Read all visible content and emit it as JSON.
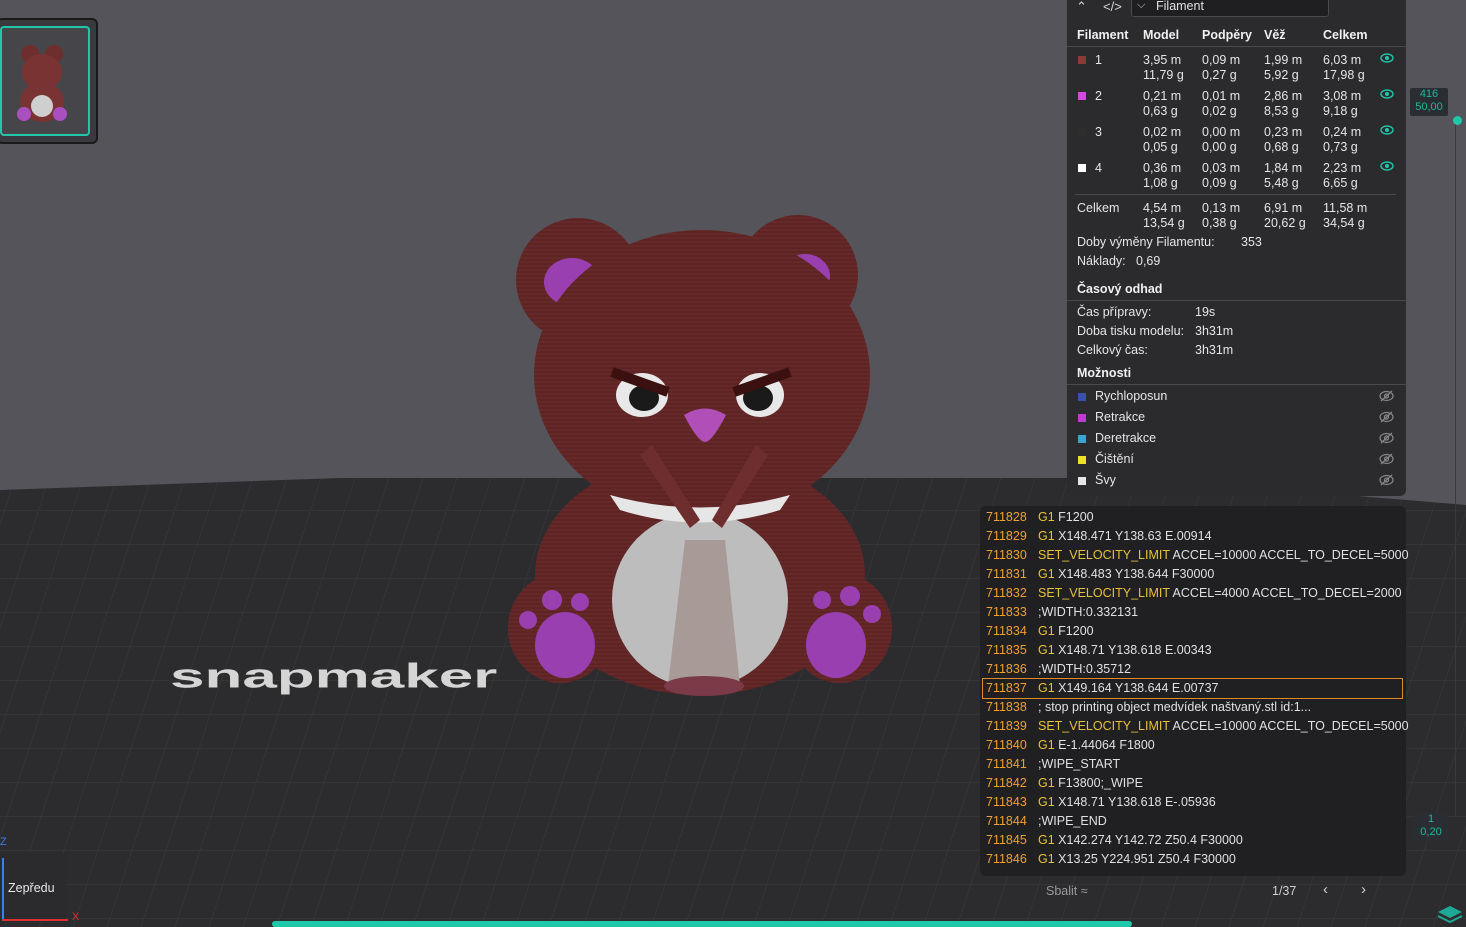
{
  "view_selector": {
    "value": "Filament"
  },
  "filament_table": {
    "headers": [
      "Filament",
      "Model",
      "Podpěry",
      "Věž",
      "Celkem"
    ],
    "rows": [
      {
        "id": "1",
        "color": "#8b3a3a",
        "model": [
          "3,95 m",
          "11,79 g"
        ],
        "supports": [
          "0,09 m",
          "0,27 g"
        ],
        "tower": [
          "1,99 m",
          "5,92 g"
        ],
        "total": [
          "6,03 m",
          "17,98 g"
        ]
      },
      {
        "id": "2",
        "color": "#d24be0",
        "model": [
          "0,21 m",
          "0,63 g"
        ],
        "supports": [
          "0,01 m",
          "0,02 g"
        ],
        "tower": [
          "2,86 m",
          "8,53 g"
        ],
        "total": [
          "3,08 m",
          "9,18 g"
        ]
      },
      {
        "id": "3",
        "color": "#2e2e2e",
        "model": [
          "0,02 m",
          "0,05 g"
        ],
        "supports": [
          "0,00 m",
          "0,00 g"
        ],
        "tower": [
          "0,23 m",
          "0,68 g"
        ],
        "total": [
          "0,24 m",
          "0,73 g"
        ]
      },
      {
        "id": "4",
        "color": "#ffffff",
        "model": [
          "0,36 m",
          "1,08 g"
        ],
        "supports": [
          "0,03 m",
          "0,09 g"
        ],
        "tower": [
          "1,84 m",
          "5,48 g"
        ],
        "total": [
          "2,23 m",
          "6,65 g"
        ]
      }
    ],
    "sum": {
      "label": "Celkem",
      "model": [
        "4,54 m",
        "13,54 g"
      ],
      "supports": [
        "0,13 m",
        "0,38 g"
      ],
      "tower": [
        "6,91 m",
        "20,62 g"
      ],
      "total": [
        "11,58 m",
        "34,54 g"
      ]
    },
    "change_time": {
      "label": "Doby výměny Filamentu:",
      "value": "353"
    },
    "cost": {
      "label": "Náklady:",
      "value": "0,69"
    }
  },
  "time_estimate": {
    "title": "Časový odhad",
    "items": [
      {
        "label": "Čas přípravy:",
        "value": "19s"
      },
      {
        "label": "Doba tisku modelu:",
        "value": "3h31m"
      },
      {
        "label": "Celkový čas:",
        "value": "3h31m"
      }
    ]
  },
  "options": {
    "title": "Možnosti",
    "items": [
      {
        "label": "Rychloposun",
        "color": "#3a4fb0"
      },
      {
        "label": "Retrakce",
        "color": "#c23bd0"
      },
      {
        "label": "Deretrakce",
        "color": "#3aa6d0"
      },
      {
        "label": "Čištění",
        "color": "#f0e02a"
      },
      {
        "label": "Švy",
        "color": "#e6e6e6"
      }
    ]
  },
  "gcode": {
    "lines": [
      {
        "n": "711828",
        "kw": "G1",
        "rest": " F1200"
      },
      {
        "n": "711829",
        "kw": "G1",
        "rest": " X148.471 Y138.63 E.00914"
      },
      {
        "n": "711830",
        "kw": "SET_VELOCITY_LIMIT",
        "rest": " ACCEL=10000 ACCEL_TO_DECEL=5000"
      },
      {
        "n": "711831",
        "kw": "G1",
        "rest": " X148.483 Y138.644 F30000"
      },
      {
        "n": "711832",
        "kw": "SET_VELOCITY_LIMIT",
        "rest": " ACCEL=4000 ACCEL_TO_DECEL=2000"
      },
      {
        "n": "711833",
        "kw": "",
        "rest": ";WIDTH:0.332131"
      },
      {
        "n": "711834",
        "kw": "G1",
        "rest": " F1200"
      },
      {
        "n": "711835",
        "kw": "G1",
        "rest": " X148.71 Y138.618 E.00343"
      },
      {
        "n": "711836",
        "kw": "",
        "rest": ";WIDTH:0.35712"
      },
      {
        "n": "711837",
        "kw": "G1",
        "rest": " X149.164 Y138.644 E.00737"
      },
      {
        "n": "711838",
        "kw": "",
        "rest": "; stop printing object medvídek naštvaný.stl id:1..."
      },
      {
        "n": "711839",
        "kw": "SET_VELOCITY_LIMIT",
        "rest": " ACCEL=10000 ACCEL_TO_DECEL=5000"
      },
      {
        "n": "711840",
        "kw": "G1",
        "rest": " E-1.44064 F1800"
      },
      {
        "n": "711841",
        "kw": "",
        "rest": ";WIPE_START"
      },
      {
        "n": "711842",
        "kw": "G1",
        "rest": " F13800;_WIPE"
      },
      {
        "n": "711843",
        "kw": "G1",
        "rest": " X148.71 Y138.618 E-.05936"
      },
      {
        "n": "711844",
        "kw": "",
        "rest": ";WIPE_END"
      },
      {
        "n": "711845",
        "kw": "G1",
        "rest": " X142.274 Y142.72 Z50.4 F30000"
      },
      {
        "n": "711846",
        "kw": "G1",
        "rest": " X13.25 Y224.951 Z50.4 F30000"
      }
    ],
    "highlighted_index": 9,
    "collapse_label": "Sbalit",
    "page": "1/37"
  },
  "layer_slider": {
    "top_layer": "416",
    "top_height": "50,00",
    "bottom_layer": "1",
    "bottom_height": "0,20"
  },
  "view_button": {
    "label": "Zepředu"
  },
  "axis": {
    "x": "X",
    "z": "Z"
  },
  "bed_logo_text": "snapmaker"
}
